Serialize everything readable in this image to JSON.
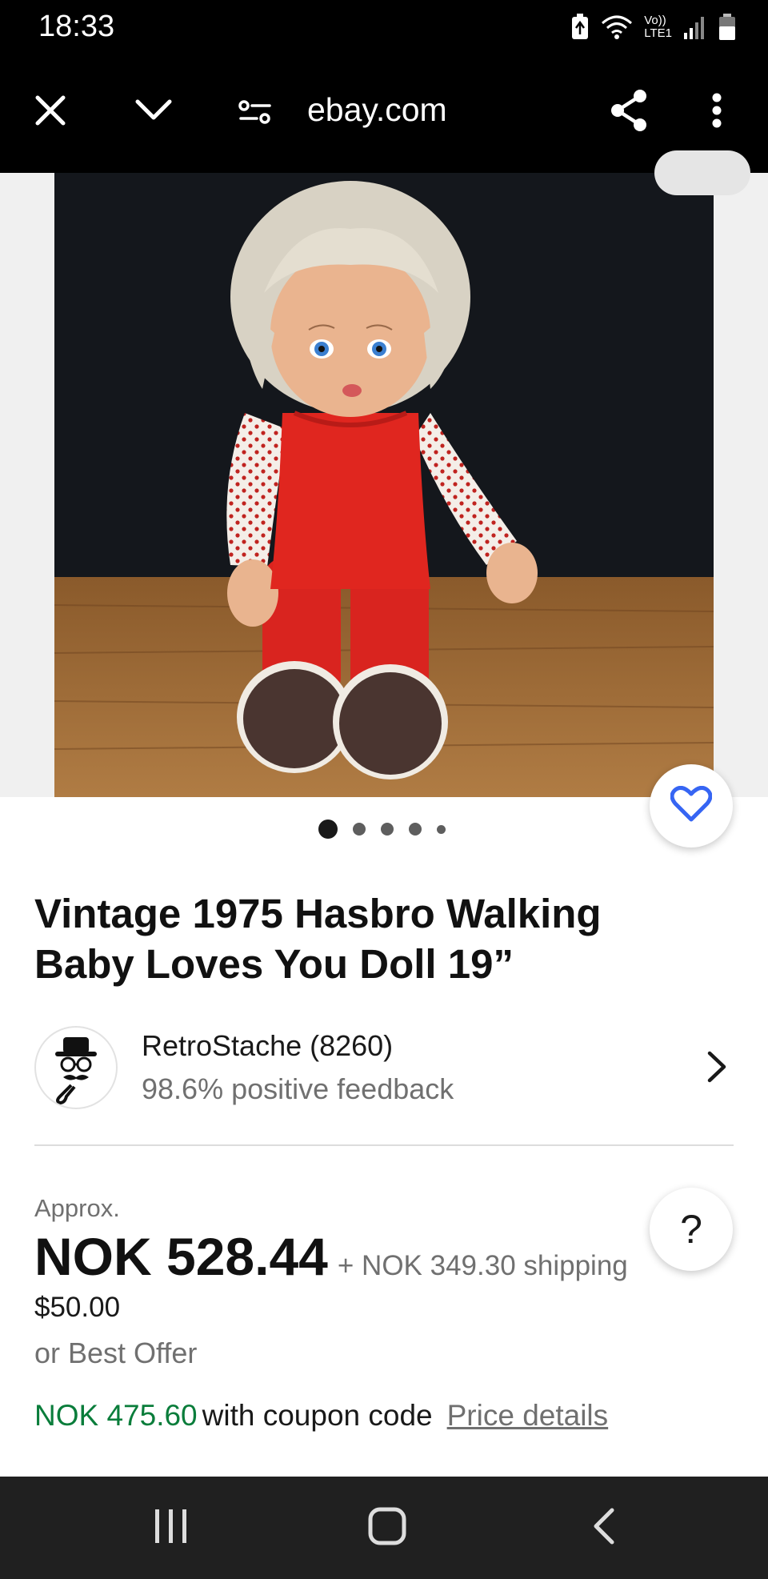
{
  "status_bar": {
    "time": "18:33",
    "volte_label": "Vo))",
    "lte_label": "LTE1",
    "icons": [
      "battery-saver-icon",
      "wifi-icon",
      "signal-icon",
      "battery-icon"
    ]
  },
  "browser": {
    "url": "ebay.com",
    "icons": [
      "close-icon",
      "chevron-down-icon",
      "site-settings-icon",
      "share-icon",
      "more-icon"
    ]
  },
  "gallery": {
    "image_count_dots": 5,
    "active_dot": 1,
    "favorite_icon": "heart-icon"
  },
  "listing": {
    "title": "Vintage 1975 Hasbro Walking Baby Loves You Doll 19”"
  },
  "seller": {
    "name": "RetroStache (8260)",
    "feedback": "98.6% positive feedback"
  },
  "price": {
    "approx_label": "Approx.",
    "amount": "NOK 528.44",
    "shipping": "+ NOK 349.30 shipping",
    "usd": "$50.00",
    "best_offer": "or Best Offer",
    "help_label": "?"
  },
  "coupon": {
    "price": "NOK 475.60",
    "text": "with coupon code",
    "details_link": "Price details"
  },
  "colors": {
    "accent_blue": "#3665f3",
    "coupon_green": "#0a7d3b",
    "text_primary": "#191919",
    "text_secondary": "#707070"
  },
  "nav": {
    "icons": [
      "recent-apps-icon",
      "home-icon",
      "back-icon"
    ]
  }
}
